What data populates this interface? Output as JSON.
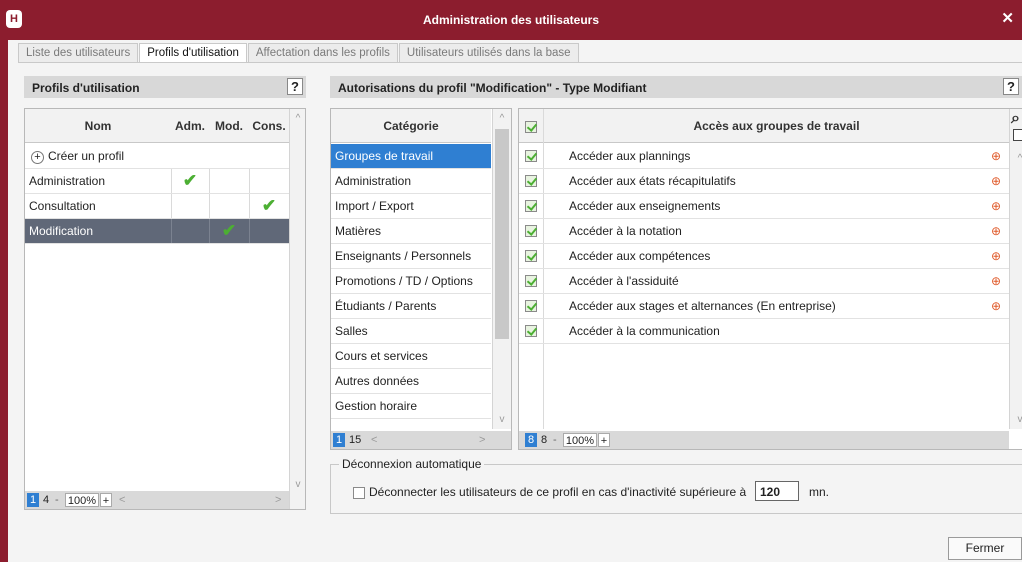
{
  "window": {
    "title": "Administration des utilisateurs",
    "logo": "H",
    "close_glyph": "✕"
  },
  "tabs": [
    {
      "label": "Liste des utilisateurs",
      "active": false
    },
    {
      "label": "Profils d'utilisation",
      "active": true
    },
    {
      "label": "Affectation dans les profils",
      "active": false
    },
    {
      "label": "Utilisateurs utilisés dans la base",
      "active": false
    }
  ],
  "left_panel": {
    "title": "Profils d'utilisation",
    "help": "?",
    "columns": [
      "Nom",
      "Adm.",
      "Mod.",
      "Cons."
    ],
    "create_label": "Créer un profil",
    "profiles": [
      {
        "name": "Administration",
        "adm": true,
        "mod": false,
        "cons": false,
        "selected": false
      },
      {
        "name": "Consultation",
        "adm": false,
        "mod": false,
        "cons": true,
        "selected": false
      },
      {
        "name": "Modification",
        "adm": false,
        "mod": true,
        "cons": false,
        "selected": true
      }
    ],
    "footer": {
      "page": "1",
      "count": "4",
      "minus": "-",
      "zoom": "100%",
      "plus": "+"
    }
  },
  "right_panel": {
    "title": "Autorisations du profil \"Modification\" - Type Modifiant",
    "help": "?",
    "category_header": "Catégorie",
    "categories": [
      "Groupes de travail",
      "Administration",
      "Import / Export",
      "Matières",
      "Enseignants / Personnels",
      "Promotions / TD / Options",
      "Étudiants / Parents",
      "Salles",
      "Cours et services",
      "Autres données",
      "Gestion horaire"
    ],
    "selected_category": 0,
    "category_footer": {
      "page": "1",
      "count": "15"
    },
    "access_header": "Accès aux groupes de travail",
    "permissions": [
      {
        "label": "Accéder aux plannings",
        "checked": true,
        "globe": true
      },
      {
        "label": "Accéder aux états récapitulatifs",
        "checked": true,
        "globe": true
      },
      {
        "label": "Accéder aux enseignements",
        "checked": true,
        "globe": true
      },
      {
        "label": "Accéder à la notation",
        "checked": true,
        "globe": true
      },
      {
        "label": "Accéder aux compétences",
        "checked": true,
        "globe": true
      },
      {
        "label": "Accéder à l'assiduité",
        "checked": true,
        "globe": true
      },
      {
        "label": "Accéder aux stages et alternances (En entreprise)",
        "checked": true,
        "globe": true
      },
      {
        "label": "Accéder à la communication",
        "checked": true,
        "globe": false
      }
    ],
    "access_footer": {
      "page": "8",
      "count": "8",
      "minus": "-",
      "zoom": "100%",
      "plus": "+"
    }
  },
  "auto_logout": {
    "legend": "Déconnexion automatique",
    "label": "Déconnecter les utilisateurs de ce profil en cas d'inactivité supérieure à",
    "value": "120",
    "unit": "mn.",
    "checked": false
  },
  "close_button": "Fermer",
  "icons": {
    "search": "search-icon",
    "copy": "copy-icon",
    "globe": "globe-icon",
    "add": "add-circle-icon",
    "check": "checkmark-icon"
  },
  "colors": {
    "title_bar": "#8c1d2e",
    "selection": "#2f7fd2",
    "selected_row": "#606878",
    "check": "#4caf33",
    "globe": "#e05a2a"
  }
}
